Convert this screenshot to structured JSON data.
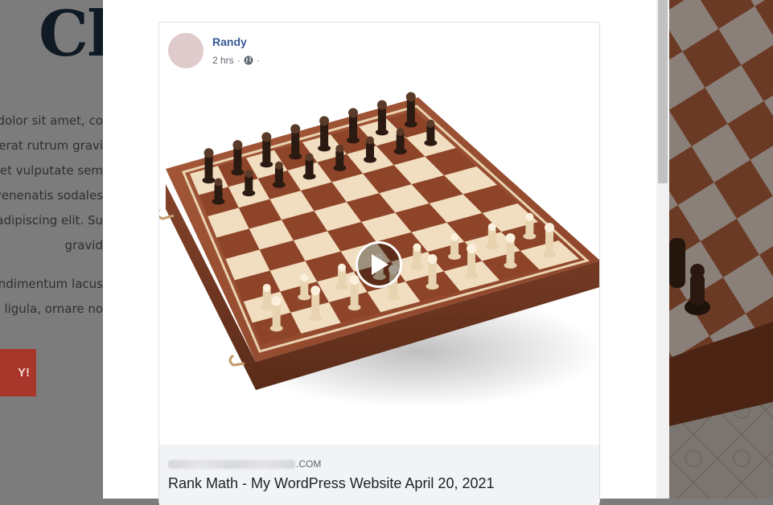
{
  "background": {
    "heading_fragment": "Cl",
    "text_lines": [
      "dolor sit amet, co",
      "erat rutrum gravi",
      "et vulputate sem",
      "venenatis sodales",
      "adipiscing elit. Su",
      "gravid",
      "ndimentum lacus",
      "s ligula, ornare no"
    ],
    "cta_fragment": "Y!",
    "cta_color": "#a8362a"
  },
  "post": {
    "author": "Randy",
    "time": "2 hrs",
    "separator_1": "·",
    "separator_2": "·",
    "privacy_icon": "globe-icon",
    "media": {
      "image_subject": "wooden chess board with pieces",
      "play_icon": "play-icon"
    },
    "link": {
      "domain_suffix": ".COM",
      "title": "Rank Math - My WordPress Website April 20, 2021"
    }
  },
  "colors": {
    "author_link": "#385898",
    "meta_text": "#616770",
    "link_bg": "#f2f3f5",
    "overlay": "#7c7c7c"
  }
}
